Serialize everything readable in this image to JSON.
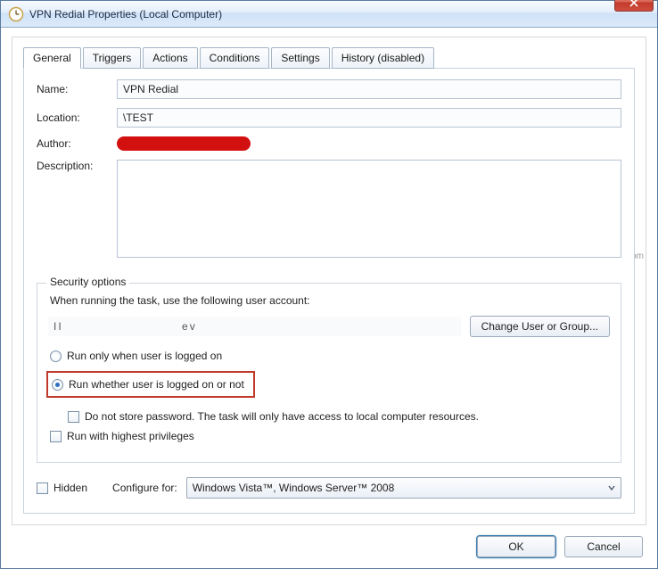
{
  "window": {
    "title": "VPN Redial Properties (Local Computer)"
  },
  "tabs": {
    "general": "General",
    "triggers": "Triggers",
    "actions": "Actions",
    "conditions": "Conditions",
    "settings": "Settings",
    "history": "History (disabled)"
  },
  "general": {
    "name_label": "Name:",
    "name_value": "VPN Redial",
    "location_label": "Location:",
    "location_value": "\\TEST",
    "author_label": "Author:",
    "description_label": "Description:",
    "description_value": ""
  },
  "security": {
    "legend": "Security options",
    "prompt": "When running the task, use the following user account:",
    "account_display": "II                         ev",
    "change_button": "Change User or Group...",
    "radio_logged_on": "Run only when user is logged on",
    "radio_whether": "Run whether user is logged on or not",
    "no_store_pw": "Do not store password.  The task will only have access to local computer resources.",
    "highest_priv": "Run with highest privileges"
  },
  "bottom": {
    "hidden_label": "Hidden",
    "configure_label": "Configure for:",
    "configure_value": "Windows Vista™, Windows Server™ 2008"
  },
  "buttons": {
    "ok": "OK",
    "cancel": "Cancel"
  },
  "watermark": "wsxdn.com"
}
